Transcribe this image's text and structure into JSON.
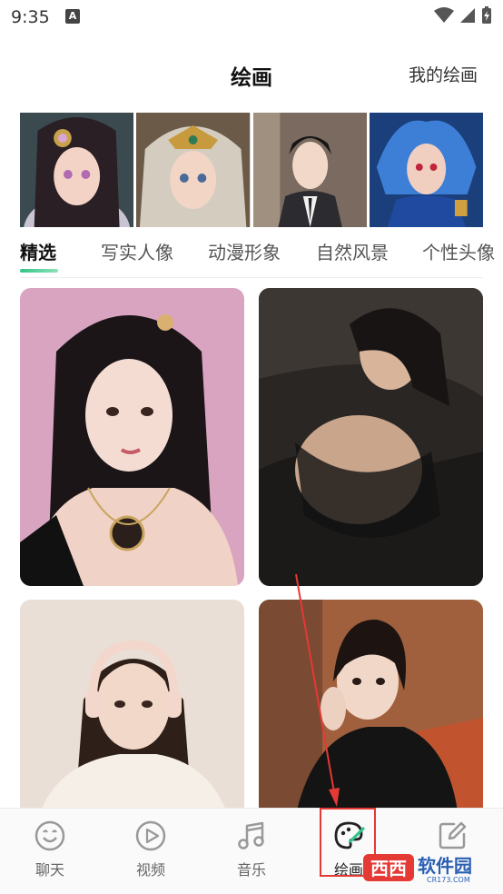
{
  "status_bar": {
    "time": "9:35",
    "notification_badge": "A"
  },
  "header": {
    "title": "绘画",
    "my_drawings": "我的绘画"
  },
  "tabs": [
    {
      "label": "精选",
      "active": true
    },
    {
      "label": "写实人像",
      "active": false
    },
    {
      "label": "动漫形象",
      "active": false
    },
    {
      "label": "自然风景",
      "active": false
    },
    {
      "label": "个性头像",
      "active": false
    }
  ],
  "bottom_nav": [
    {
      "label": "聊天",
      "icon": "smile-chat-icon"
    },
    {
      "label": "视频",
      "icon": "play-circle-icon"
    },
    {
      "label": "音乐",
      "icon": "music-note-icon"
    },
    {
      "label": "绘画",
      "icon": "palette-brush-icon"
    },
    {
      "label": "",
      "icon": "edit-square-icon"
    }
  ],
  "watermark": {
    "text": "西西软件园",
    "url_text": "CR173.COM"
  },
  "colors": {
    "accent": "#32c587",
    "annotation": "#e53935"
  }
}
